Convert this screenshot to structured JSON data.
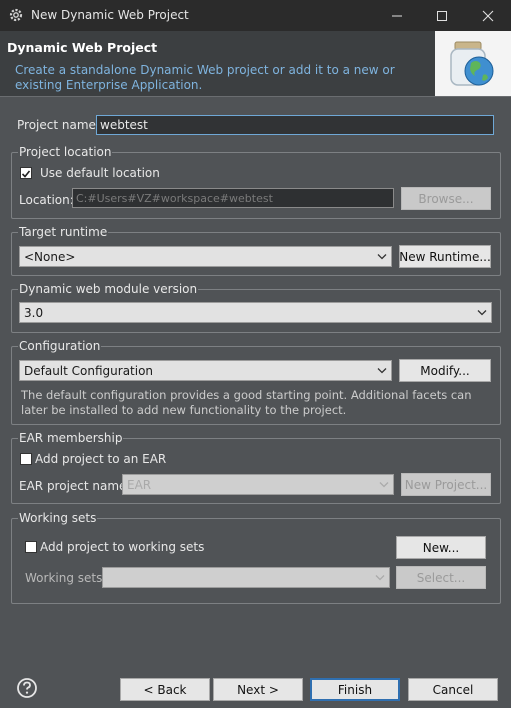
{
  "window": {
    "title": "New Dynamic Web Project",
    "icon": "gear-icon"
  },
  "header": {
    "title": "Dynamic Web Project",
    "description": "Create a standalone Dynamic Web project or add it to a new or existing Enterprise Application."
  },
  "project_name": {
    "label": "Project name:",
    "value": "webtest"
  },
  "project_location": {
    "group_label": "Project location",
    "use_default_label": "Use default location",
    "use_default_checked": true,
    "location_label": "Location:",
    "location_value": "C:#Users#VZ#workspace#webtest",
    "browse_label": "Browse..."
  },
  "target_runtime": {
    "group_label": "Target runtime",
    "selected": "<None>",
    "new_runtime_label": "New Runtime..."
  },
  "module_version": {
    "group_label": "Dynamic web module version",
    "selected": "3.0"
  },
  "configuration": {
    "group_label": "Configuration",
    "selected": "Default Configuration",
    "modify_label": "Modify...",
    "description": "The default configuration provides a good starting point. Additional facets can later be installed to add new functionality to the project."
  },
  "ear_membership": {
    "group_label": "EAR membership",
    "add_label": "Add project to an EAR",
    "add_checked": false,
    "ear_name_label": "EAR project name:",
    "ear_name_value": "EAR",
    "new_project_label": "New Project..."
  },
  "working_sets": {
    "group_label": "Working sets",
    "add_label": "Add project to working sets",
    "add_checked": false,
    "new_label": "New...",
    "sets_label": "Working sets:",
    "sets_value": "",
    "select_label": "Select..."
  },
  "footer": {
    "back_label": "< Back",
    "next_label": "Next >",
    "finish_label": "Finish",
    "cancel_label": "Cancel"
  },
  "colors": {
    "accent_focus": "#6fa8d6",
    "header_desc": "#7fb4df",
    "dialog_bg": "#505356"
  }
}
